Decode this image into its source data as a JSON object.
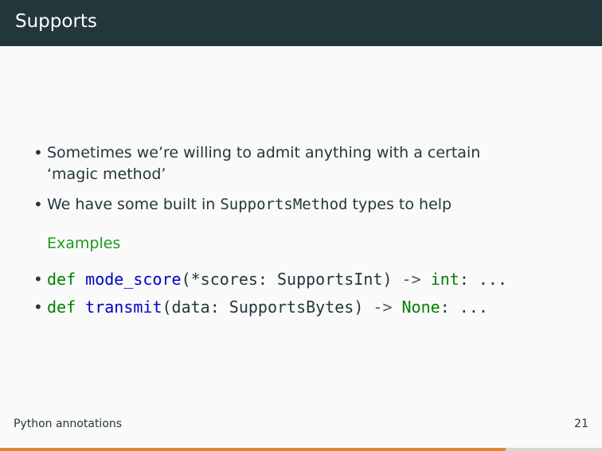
{
  "header": {
    "title": "Supports"
  },
  "bullets": [
    {
      "marker": "•",
      "text": "Sometimes we’re willing to admit anything with a certain ‘magic method’"
    },
    {
      "marker": "•",
      "prefix": "We have some built in ",
      "mono": "SupportsMethod",
      "suffix": " types to help"
    }
  ],
  "examples": {
    "title": "Examples",
    "lines": [
      {
        "marker": "•",
        "def": "def",
        "name": "mode_score",
        "open": "(*scores: SupportsInt) ",
        "arrow": "->",
        "ret": "int",
        "tail": ": ..."
      },
      {
        "marker": "•",
        "def": "def",
        "name": "transmit",
        "open": "(data: SupportsBytes) ",
        "arrow": "->",
        "ret": "None",
        "tail": ": ..."
      }
    ]
  },
  "footer": {
    "left": "Python annotations",
    "page": "21"
  },
  "progress": {
    "fraction": 0.84,
    "fill_color": "#e0863b",
    "track_color": "#d6d6d6"
  }
}
